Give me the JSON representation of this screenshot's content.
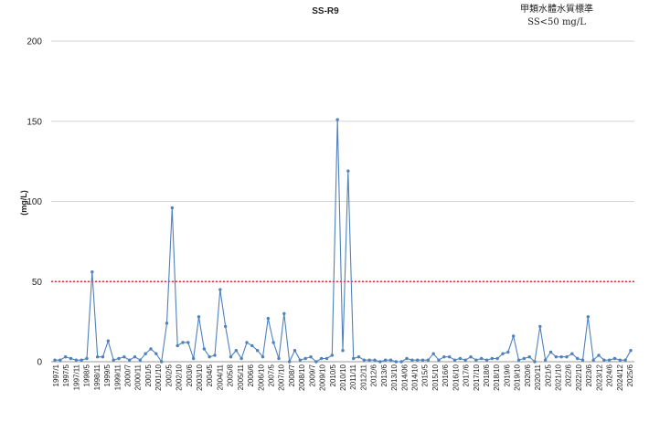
{
  "chart_data": {
    "type": "line",
    "title": "SS-R9",
    "annotation": [
      "甲類水體水質標準",
      "SS<50 mg/L"
    ],
    "ylabel": "(mg/L)",
    "xlabel": "",
    "ylim": [
      0,
      200
    ],
    "yticks": [
      0,
      50,
      100,
      150,
      200
    ],
    "grid": "horizontal",
    "reference_line": {
      "value": 50,
      "color": "#e03030",
      "style": "dotted"
    },
    "series_color": "#4f81bd",
    "x_tick_labels": [
      "1997/1",
      "1997/5",
      "1997/11",
      "1998/5",
      "1998/11",
      "1999/5",
      "1999/11",
      "2000/7",
      "2000/11",
      "2001/5",
      "2001/10",
      "2002/5",
      "2002/10",
      "2003/6",
      "2003/10",
      "2004/5",
      "2004/11",
      "2005/8",
      "2005/11",
      "2006/6",
      "2006/10",
      "2007/5",
      "2007/10",
      "2008/7",
      "2008/10",
      "2009/7",
      "2009/10",
      "2010/5",
      "2010/10",
      "2011/11",
      "2012/11",
      "2012/6",
      "2013/6",
      "2013/10",
      "2014/06",
      "2014/10",
      "2015/5",
      "2015/10",
      "2016/6",
      "2016/10",
      "2017/6",
      "2017/10",
      "2018/6",
      "2018/10",
      "2019/6",
      "2019/10",
      "2020/6",
      "2020/11",
      "2021/5",
      "2021/10",
      "2022/6",
      "2022/10",
      "2023/6",
      "2023/12",
      "2024/6",
      "2024/12",
      "2025/6"
    ],
    "values": [
      1,
      1,
      3,
      2,
      1,
      1,
      2,
      56,
      3,
      3,
      13,
      1,
      2,
      3,
      1,
      3,
      1,
      5,
      8,
      5,
      0,
      24,
      96,
      10,
      12,
      12,
      2,
      28,
      8,
      3,
      4,
      45,
      22,
      3,
      7,
      2,
      12,
      10,
      7,
      3,
      27,
      12,
      2,
      30,
      0,
      7,
      1,
      2,
      3,
      0,
      2,
      2,
      4,
      151,
      7,
      119,
      2,
      3,
      1,
      1,
      1,
      0,
      1,
      1,
      0,
      0,
      2,
      1,
      1,
      1,
      1,
      5,
      1,
      3,
      3,
      1,
      2,
      1,
      3,
      1,
      2,
      1,
      2,
      2,
      5,
      6,
      16,
      1,
      2,
      3,
      0,
      22,
      1,
      6,
      3,
      3,
      3,
      5,
      2,
      1,
      28,
      1,
      4,
      1,
      1,
      2,
      1,
      1,
      7
    ]
  }
}
